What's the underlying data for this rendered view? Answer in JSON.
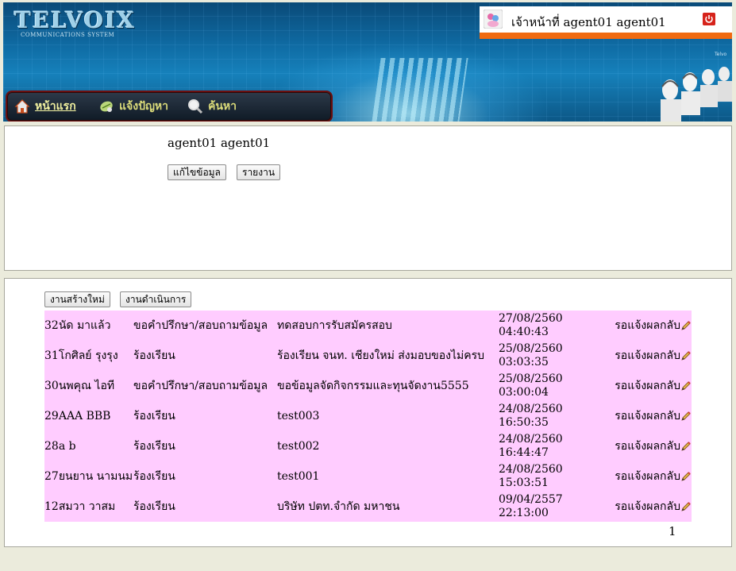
{
  "header": {
    "logo_title": "TELVOIX",
    "logo_subtitle": "COMMUNICATIONS SYSTEM",
    "corner_text": "Telvo",
    "user_label": "เจ้าหน้าที่ agent01 agent01",
    "nav": [
      {
        "label": "หน้าแรก",
        "icon": "home-icon",
        "active": true
      },
      {
        "label": "แจ้งปัญหา",
        "icon": "report-icon",
        "active": false
      },
      {
        "label": "ค้นหา",
        "icon": "search-icon",
        "active": false
      }
    ]
  },
  "profile": {
    "name": "agent01 agent01",
    "edit_button": "แก้ไขข้อมูล",
    "report_button": "รายงาน"
  },
  "tasks": {
    "new_button": "งานสร้างใหม่",
    "inprogress_button": "งานดำเนินการ",
    "rows": [
      {
        "id": "32",
        "name": "นัด มาแล้ว",
        "type": "ขอคำปรึกษา/สอบถามข้อมูล",
        "subject": "ทดสอบการรับสมัครสอบ",
        "date": "27/08/2560",
        "time": "04:40:43",
        "status": "รอแจ้งผลกลับ"
      },
      {
        "id": "31",
        "name": "โกศิลย์ รุงรุง",
        "type": "ร้องเรียน",
        "subject": "ร้องเรียน จนท. เชียงใหม่ ส่งมอบของไม่ครบ",
        "date": "25/08/2560",
        "time": "03:03:35",
        "status": "รอแจ้งผลกลับ"
      },
      {
        "id": "30",
        "name": "นพคุณ ไอที",
        "type": "ขอคำปรึกษา/สอบถามข้อมูล",
        "subject": "ขอข้อมูลจัดกิจกรรมและทุนจัดงาน5555",
        "date": "25/08/2560",
        "time": "03:00:04",
        "status": "รอแจ้งผลกลับ"
      },
      {
        "id": "29",
        "name": "AAA BBB",
        "type": "ร้องเรียน",
        "subject": "test003",
        "date": "24/08/2560",
        "time": "16:50:35",
        "status": "รอแจ้งผลกลับ"
      },
      {
        "id": "28",
        "name": "a b",
        "type": "ร้องเรียน",
        "subject": "test002",
        "date": "24/08/2560",
        "time": "16:44:47",
        "status": "รอแจ้งผลกลับ"
      },
      {
        "id": "27",
        "name": "ยนยาน นามนม",
        "type": "ร้องเรียน",
        "subject": "test001",
        "date": "24/08/2560",
        "time": "15:03:51",
        "status": "รอแจ้งผลกลับ"
      },
      {
        "id": "12",
        "name": "สมวา วาสม",
        "type": "ร้องเรียน",
        "subject": "บริษัท ปตท.จำกัด มหาชน",
        "date": "09/04/2557",
        "time": "22:13:00",
        "status": "รอแจ้งผลกลับ"
      }
    ],
    "page": "1"
  }
}
